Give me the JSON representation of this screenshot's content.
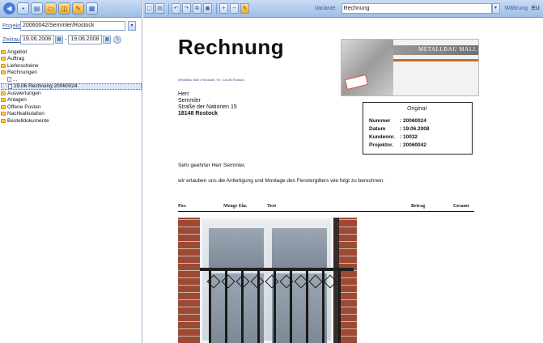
{
  "app": {
    "projekt_label": "Projekt",
    "projekt_value": "20060042/Semmler/Rostock",
    "zeitraum_label": "Zeitraum",
    "date_from": "19.06.2008",
    "date_to": "19.06.2008"
  },
  "tree": [
    {
      "label": "Angebot",
      "type": "folder"
    },
    {
      "label": "Auftrag",
      "type": "folder"
    },
    {
      "label": "Lieferscheine",
      "type": "folder"
    },
    {
      "label": "Rechnungen",
      "type": "folder"
    },
    {
      "label": "...",
      "type": "doc",
      "indent": true
    },
    {
      "label": "19.06 Rechnung 20060024",
      "type": "doc",
      "indent": true,
      "selected": true
    },
    {
      "label": "Auswertungen",
      "type": "folder"
    },
    {
      "label": "Anlagen",
      "type": "folder"
    },
    {
      "label": "Offene Posten",
      "type": "folder"
    },
    {
      "label": "Nachkalkulation",
      "type": "folder"
    },
    {
      "label": "Bestelldokumente",
      "type": "folder"
    }
  ],
  "header": {
    "variante_label": "Variante",
    "variante_value": "Rechnung",
    "waehrung_label": "Währung",
    "waehrung_value": "EU"
  },
  "document": {
    "title": "Rechnung",
    "sender_line": "Metallbau Mall • Hansastr. 90 • 18146 Rostock",
    "logo_text": "METALLBAU MALL",
    "address": [
      "Herr",
      "Semmler",
      "Straße der Nationen 15",
      "18148 Rostock"
    ],
    "info_title": "Original",
    "info": [
      {
        "k": "Nummer",
        "v": ": 20060024"
      },
      {
        "k": "Datum",
        "v": ": 19.06.2008"
      },
      {
        "k": "Kundennr.",
        "v": ": 10032"
      },
      {
        "k": "Projektnr.",
        "v": ": 20060042"
      }
    ],
    "greeting": "Sehr geehrter Herr Semmler,",
    "body": "wir erlauben uns die Anfertigung und Montage des Fenstergitters wie folgt zu berechnen.",
    "columns": [
      "Pos.",
      "Menge Ein.",
      "Text",
      "Betrag",
      "Gesamt"
    ]
  }
}
